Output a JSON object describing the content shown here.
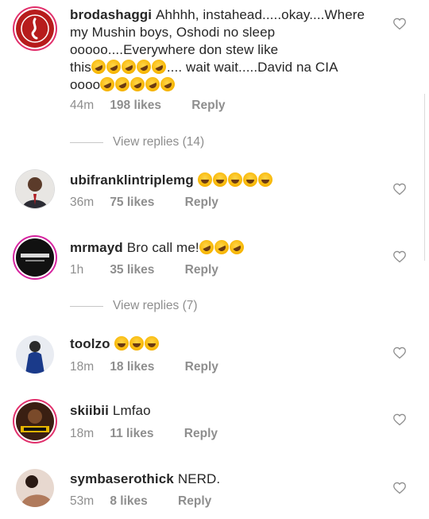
{
  "comments": [
    {
      "username": "brodashaggi",
      "text_lines": [
        "Ahhhh, instahead.....okay....Where",
        "my Mushin boys, Oshodi no sleep",
        "ooooo....Everywhere don stew like",
        "this",
        ".... wait wait.....David na CIA",
        "oooo"
      ],
      "time": "44m",
      "likes": "198 likes",
      "reply": "Reply",
      "view_replies": "View replies (14)"
    },
    {
      "username": "ubifranklintriplemg",
      "text": "",
      "time": "36m",
      "likes": "75 likes",
      "reply": "Reply"
    },
    {
      "username": "mrmayd",
      "text": "Bro call me!",
      "time": "1h",
      "likes": "35 likes",
      "reply": "Reply",
      "view_replies": "View replies (7)"
    },
    {
      "username": "toolzo",
      "text": "",
      "time": "18m",
      "likes": "18 likes",
      "reply": "Reply"
    },
    {
      "username": "skiibii",
      "text": "Lmfao",
      "time": "18m",
      "likes": "11 likes",
      "reply": "Reply"
    },
    {
      "username": "symbaserothick",
      "text": "NERD.",
      "time": "53m",
      "likes": "8 likes",
      "reply": "Reply"
    }
  ],
  "icons": {
    "heart": "heart-outline-icon",
    "emoji_rofl": "rolling-on-floor-laughing-emoji",
    "emoji_grin": "grinning-squinting-face-emoji"
  },
  "colors": {
    "text": "#262626",
    "meta": "#8e8e8e",
    "story_ring": "#e1306c"
  }
}
